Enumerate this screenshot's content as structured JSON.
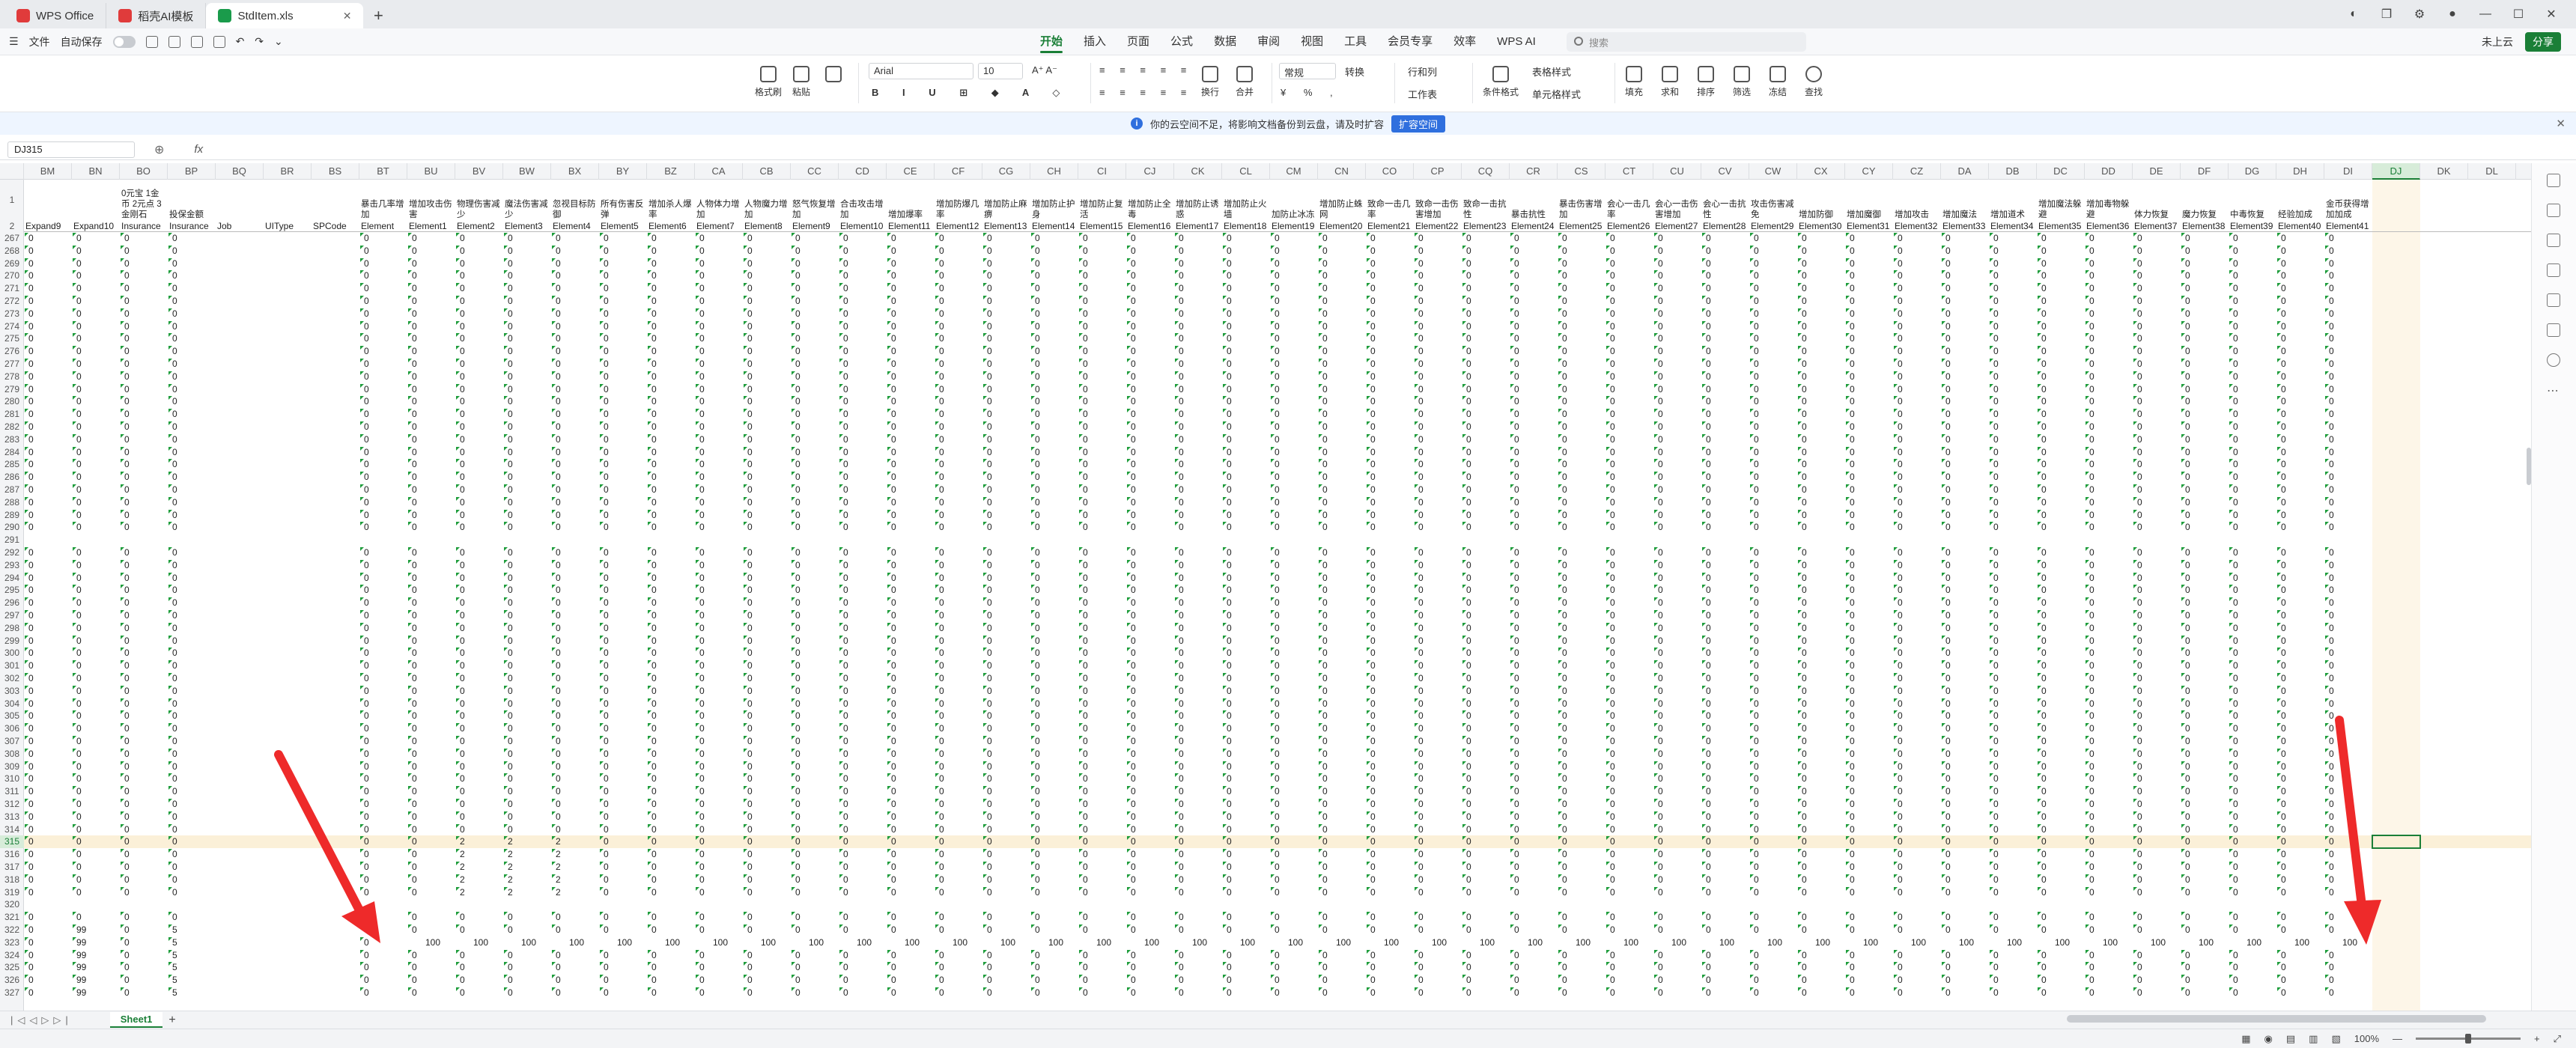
{
  "window_tabs": [
    {
      "label": "WPS Office",
      "color": "#e03b3b"
    },
    {
      "label": "稻壳AI模板",
      "color": "#e03b3b"
    },
    {
      "label": "StdItem.xls",
      "color": "#1a9b4b"
    }
  ],
  "menu": {
    "file": "文件",
    "autosave": "自动保存",
    "tabs": [
      "开始",
      "插入",
      "页面",
      "公式",
      "数据",
      "审阅",
      "视图",
      "工具",
      "会员专享",
      "效率",
      "WPS AI"
    ],
    "search_placeholder": "搜索",
    "cloud": "未上云",
    "share": "分享"
  },
  "ribbon": {
    "format_painter": "格式刷",
    "paste": "粘贴",
    "font_name": "Arial",
    "font_size": "10",
    "number_format": "常规",
    "convert": "转换",
    "wrap": "换行",
    "merge": "合并",
    "rows_cols": "行和列",
    "worksheet": "工作表",
    "cond_format": "条件格式",
    "table_style": "表格样式",
    "cell_style": "单元格样式",
    "fill": "填充",
    "sum": "求和",
    "sort": "排序",
    "filter": "筛选",
    "freeze": "冻结",
    "find": "查找"
  },
  "infobar": {
    "text": "你的云空间不足，将影响文档备份到云盘，请及时扩容",
    "button": "扩容空间"
  },
  "formula": {
    "namebox": "DJ315",
    "fx": "fx",
    "value": ""
  },
  "grid": {
    "selected_column": "DJ",
    "selected_row": "315",
    "columns": [
      "BM",
      "BN",
      "BO",
      "BP",
      "BQ",
      "BR",
      "BS",
      "BT",
      "BU",
      "BV",
      "BW",
      "BX",
      "BY",
      "BZ",
      "CA",
      "CB",
      "CC",
      "CD",
      "CE",
      "CF",
      "CG",
      "CH",
      "CI",
      "CJ",
      "CK",
      "CL",
      "CM",
      "CN",
      "CO",
      "CP",
      "CQ",
      "CR",
      "CS",
      "CT",
      "CU",
      "CV",
      "CW",
      "CX",
      "CY",
      "CZ",
      "DA",
      "DB",
      "DC",
      "DD",
      "DE",
      "DF",
      "DG",
      "DH",
      "DI",
      "DJ",
      "DK",
      "DL"
    ],
    "header_row1": [
      "",
      "",
      "0元宝 1金币 2元点 3金刚石",
      "投保金额",
      "",
      "",
      "",
      "暴击几率增加",
      "增加攻击伤害",
      "物理伤害减少",
      "魔法伤害减少",
      "忽视目标防御",
      "所有伤害反弹",
      "增加杀人爆率",
      "人物体力增加",
      "人物魔力增加",
      "怒气恢复增加",
      "合击攻击增加",
      "增加爆率",
      "增加防爆几率",
      "增加防止麻痹",
      "增加防止护身",
      "增加防止复活",
      "增加防止全毒",
      "增加防止诱惑",
      "增加防止火墙",
      "加防止冰冻",
      "增加防止蛛网",
      "致命一击几率",
      "致命一击伤害增加",
      "致命一击抗性",
      "暴击抗性",
      "暴击伤害增加",
      "会心一击几率",
      "会心一击伤害增加",
      "会心一击抗性",
      "攻击伤害减免",
      "增加防御",
      "增加魔御",
      "增加攻击",
      "增加魔法",
      "增加道术",
      "增加魔法躲避",
      "增加毒物躲避",
      "体力恢复",
      "魔力恢复",
      "中毒恢复",
      "经验加成",
      "金币获得增加加成",
      "",
      "",
      ""
    ],
    "header_row2": [
      "Expand9",
      "Expand10",
      "Insurance",
      "Insurance",
      "Job",
      "UIType",
      "SPCode",
      "Element",
      "Element1",
      "Element2",
      "Element3",
      "Element4",
      "Element5",
      "Element6",
      "Element7",
      "Element8",
      "Element9",
      "Element10",
      "Element11",
      "Element12",
      "Element13",
      "Element14",
      "Element15",
      "Element16",
      "Element17",
      "Element18",
      "Element19",
      "Element20",
      "Element21",
      "Element22",
      "Element23",
      "Element24",
      "Element25",
      "Element26",
      "Element27",
      "Element28",
      "Element29",
      "Element30",
      "Element31",
      "Element32",
      "Element33",
      "Element34",
      "Element35",
      "Element36",
      "Element37",
      "Element38",
      "Element39",
      "Element40",
      "Element41",
      "",
      "",
      ""
    ],
    "row_numbers_start": 267,
    "row_numbers_end": 327,
    "empty_rows": [
      291,
      320
    ],
    "special_rows": {
      "315": {
        "BV": "2",
        "BW": "2",
        "BX": "2"
      },
      "316": {
        "BV": "2",
        "BW": "2",
        "BX": "2"
      },
      "317": {
        "BV": "2",
        "BW": "2",
        "BX": "2"
      },
      "318": {
        "BV": "2",
        "BW": "2",
        "BX": "2"
      },
      "319": {
        "BV": "2",
        "BW": "2",
        "BX": "2"
      }
    },
    "row_323_value": "100",
    "value_99": "99",
    "value_5": "5",
    "zero": "0"
  },
  "sheet_tabs": [
    "Sheet1"
  ],
  "status": {
    "zoom": "100%"
  },
  "colors": {
    "accent": "#1a7f37",
    "arrow": "#ee2a2a",
    "triangle": "#1f9d3c"
  }
}
